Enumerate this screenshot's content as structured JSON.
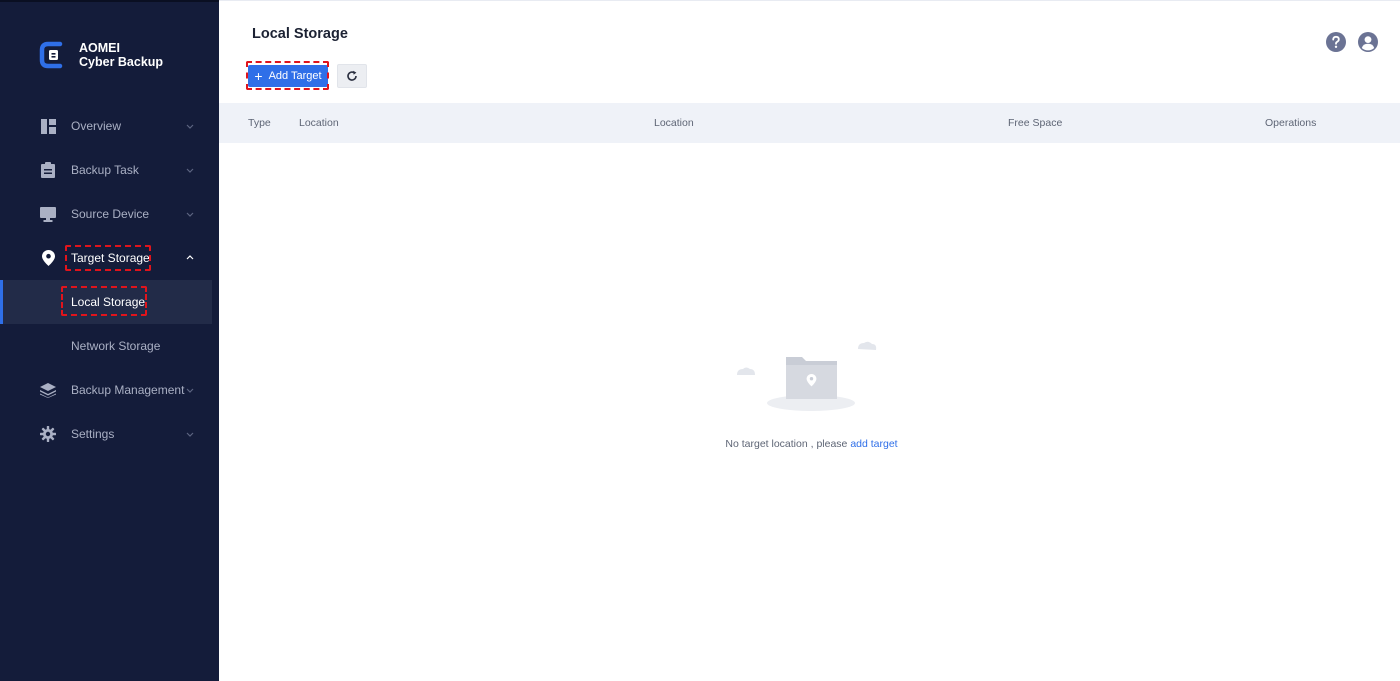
{
  "app": {
    "logo_line1": "AOMEI",
    "logo_line2": "Cyber Backup",
    "accent": "#2f6fe8",
    "sidebar_bg": "#141c3a"
  },
  "sidebar": {
    "items": [
      {
        "label": "Overview",
        "icon": "dashboard-icon",
        "expanded": false
      },
      {
        "label": "Backup Task",
        "icon": "clipboard-icon",
        "expanded": false
      },
      {
        "label": "Source Device",
        "icon": "monitor-icon",
        "expanded": false
      },
      {
        "label": "Target Storage",
        "icon": "location-pin-icon",
        "expanded": true,
        "children": [
          {
            "label": "Local Storage",
            "active": true
          },
          {
            "label": "Network Storage",
            "active": false
          }
        ]
      },
      {
        "label": "Backup Management",
        "icon": "layers-icon",
        "expanded": false
      },
      {
        "label": "Settings",
        "icon": "gear-icon",
        "expanded": false
      }
    ]
  },
  "header": {
    "title": "Local Storage",
    "add_label": "Add Target",
    "help_icon": "question-icon",
    "user_icon": "user-icon"
  },
  "table": {
    "columns": [
      "Type",
      "Location",
      "Location",
      "Free Space",
      "Operations"
    ]
  },
  "empty": {
    "message": "No target location , please",
    "link": "add target"
  }
}
